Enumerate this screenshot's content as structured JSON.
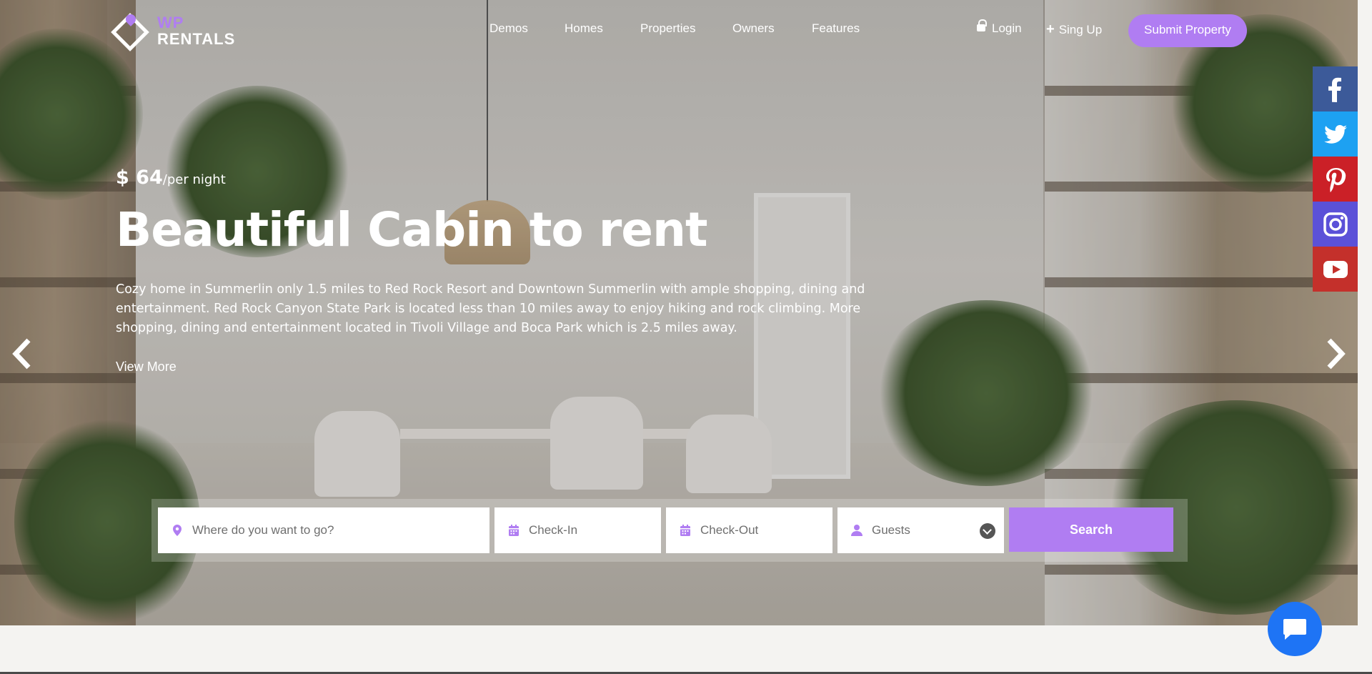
{
  "header": {
    "logo": {
      "top": "WP",
      "bottom": "RENTALS"
    },
    "nav": [
      "Demos",
      "Homes",
      "Properties",
      "Owners",
      "Features"
    ],
    "login_label": "Login",
    "signup_label": "Sing Up",
    "submit_label": "Submit Property"
  },
  "hero": {
    "price": "$ 64",
    "price_unit": "/per night",
    "title": "Beautiful Cabin to rent",
    "description": "Cozy home in Summerlin only 1.5 miles to Red Rock Resort and Downtown Summerlin with ample shopping, dining and entertainment. Red Rock Canyon State Park is located less than 10 miles away to enjoy hiking and rock climbing. More shopping, dining and entertainment located in Tivoli Village and Boca Park which is 2.5 miles away.",
    "view_more": "View More"
  },
  "social": [
    "facebook-icon",
    "twitter-icon",
    "pinterest-icon",
    "instagram-icon",
    "youtube-icon"
  ],
  "search": {
    "destination_placeholder": "Where do you want to go?",
    "checkin_placeholder": "Check-In",
    "checkout_placeholder": "Check-Out",
    "guests_placeholder": "Guests",
    "button_label": "Search"
  },
  "colors": {
    "accent": "#b07df2",
    "chat": "#1e74f5",
    "facebook": "#3c5a99",
    "twitter": "#1da1f2",
    "pinterest": "#cb2027",
    "instagram": "#5b51d8",
    "youtube": "#c4302b"
  }
}
